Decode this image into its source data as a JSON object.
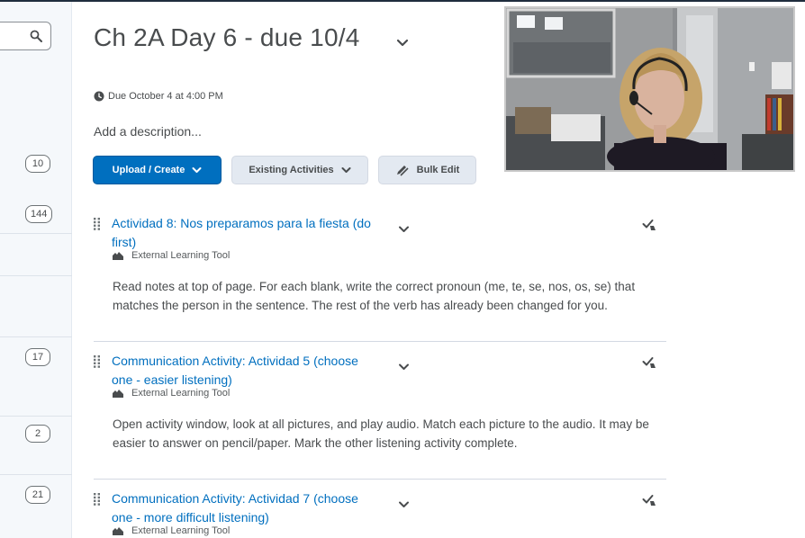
{
  "sidebar": {
    "search": {
      "placeholder": ""
    },
    "counts": [
      "10",
      "144",
      "17",
      "2",
      "21"
    ]
  },
  "header": {
    "title": "Ch 2A Day 6 - due 10/4",
    "due": "Due October 4 at 4:00 PM",
    "add_description": "Add a description..."
  },
  "toolbar": {
    "upload_label": "Upload / Create",
    "existing_label": "Existing Activities",
    "bulk_label": "Bulk Edit"
  },
  "activities": [
    {
      "title": "Actividad 8: Nos preparamos para la fiesta (do first)",
      "tool": "External Learning Tool",
      "description": "Read notes at top of page. For each blank, write the correct pronoun (me, te, se, nos, os, se) that matches the person in the sentence. The rest of the verb has already been changed for you."
    },
    {
      "title": "Communication Activity: Actividad 5 (choose one - easier listening)",
      "tool": "External Learning Tool",
      "description": "Open activity window, look at all pictures, and play audio.  Match each picture to the audio. It may be easier to answer on pencil/paper.  Mark the other listening activity complete."
    },
    {
      "title": "Communication Activity: Actividad 7 (choose one - more difficult listening)",
      "tool": "External Learning Tool",
      "description": ""
    }
  ],
  "icons": {
    "search": "search-icon",
    "chevron": "chevron-down-icon",
    "clock": "clock-icon",
    "drag": "drag-handle-icon",
    "completion": "completion-check-icon",
    "tool": "external-tool-icon",
    "bulk": "pencil-icon"
  },
  "colors": {
    "accent": "#006fbf",
    "text": "#494c4e",
    "secondary_button": "#e3e9f1",
    "sidebar_bg": "#f5f8fb"
  }
}
